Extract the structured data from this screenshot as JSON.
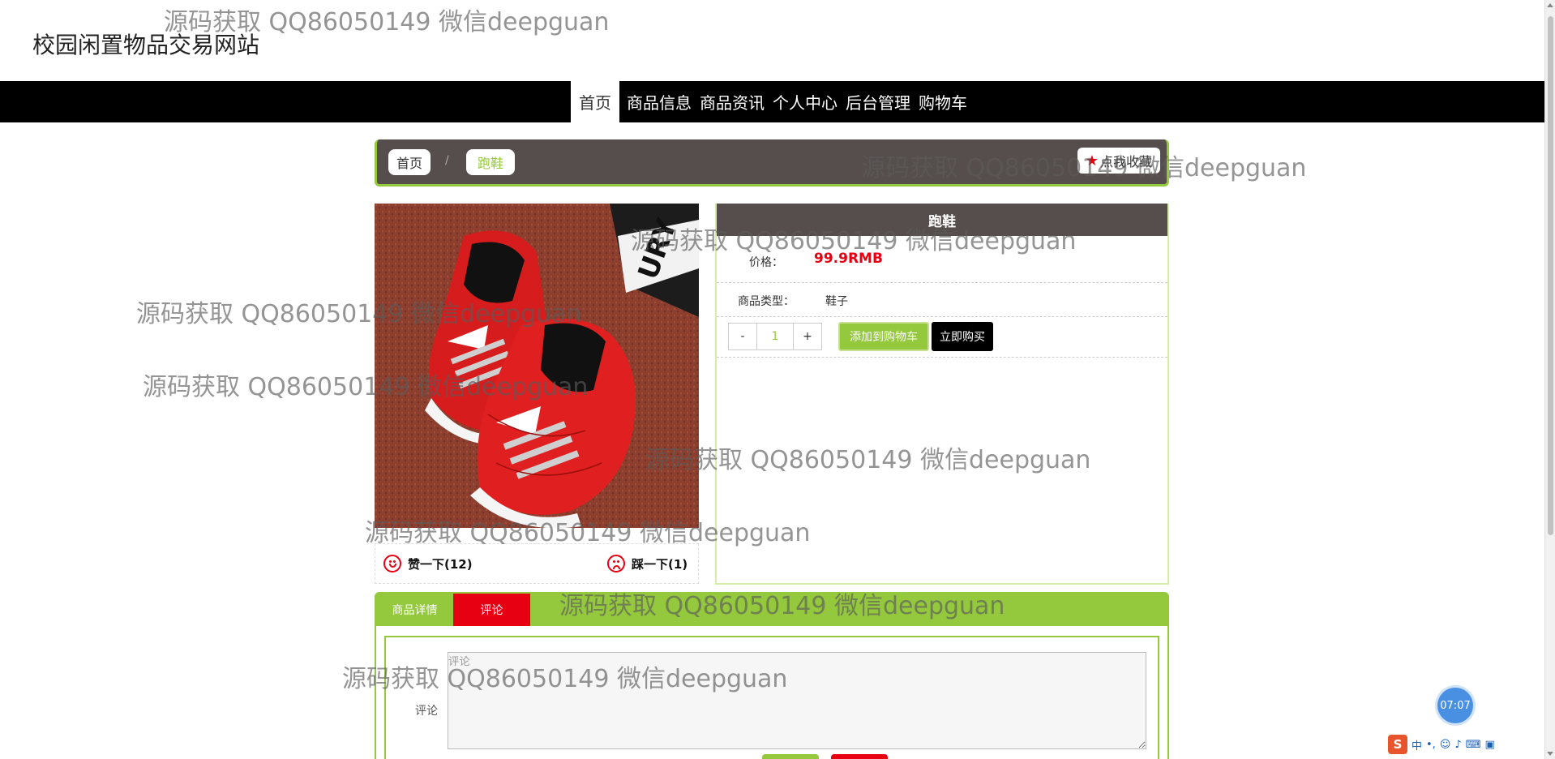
{
  "site_title": "校园闲置物品交易网站",
  "nav": {
    "items": [
      "首页",
      "商品信息",
      "商品资讯",
      "个人中心",
      "后台管理",
      "购物车"
    ],
    "active_index": 0
  },
  "breadcrumb": {
    "home": "首页",
    "separator": "/",
    "current": "跑鞋",
    "favorite": "点我收藏"
  },
  "product": {
    "title": "跑鞋",
    "price_label": "价格：",
    "price": "99.9RMB",
    "type_label": "商品类型：",
    "type": "鞋子",
    "qty_minus": "-",
    "qty": "1",
    "qty_plus": "+",
    "add_to_cart": "添加到购物车",
    "buy_now": "立即购买"
  },
  "votes": {
    "like": "赞一下(12)",
    "dislike": "踩一下(1)"
  },
  "tabs": {
    "items": [
      "商品详情",
      "评论"
    ],
    "active_index": 1
  },
  "comment": {
    "label": "评论",
    "placeholder": "评论"
  },
  "watermark": "源码获取 QQ86050149 微信deepguan",
  "timer": "07:07",
  "ime": "中",
  "colors": {
    "accent": "#94c83d",
    "dark": "#564e4c",
    "red": "#e60012",
    "nav_bg": "#000000"
  },
  "icons": [
    "star-icon",
    "smile-icon",
    "frown-icon",
    "sogou-ime-icon"
  ]
}
